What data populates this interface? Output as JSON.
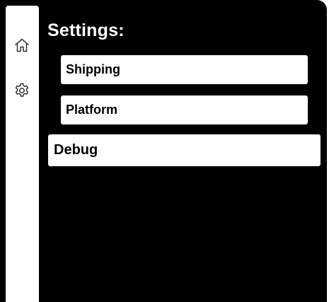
{
  "sidebar": {
    "icons": [
      {
        "name": "home-icon"
      },
      {
        "name": "gear-icon"
      }
    ]
  },
  "settings": {
    "title": "Settings:",
    "items": [
      {
        "label": "Shipping",
        "level": "sub"
      },
      {
        "label": "Platform",
        "level": "sub"
      },
      {
        "label": "Debug",
        "level": "top"
      }
    ]
  },
  "colors": {
    "background": "#000000",
    "surface": "#ffffff",
    "text_on_dark": "#ffffff",
    "text_on_light": "#000000"
  }
}
